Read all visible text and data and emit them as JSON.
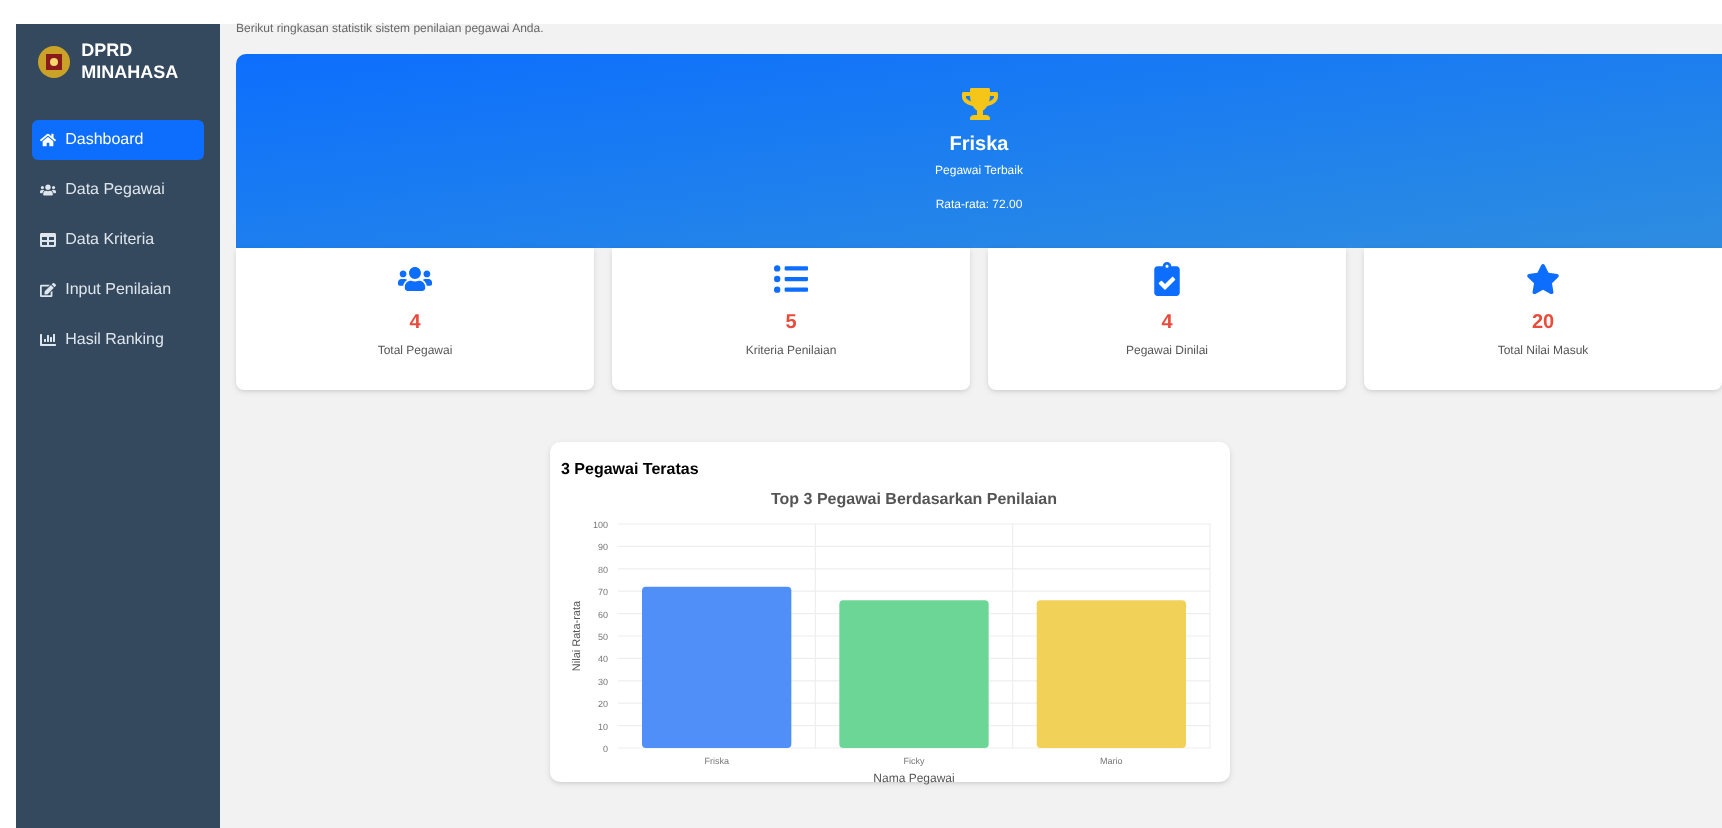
{
  "sidebar": {
    "brand": "DPRD MINAHASA",
    "items": [
      {
        "label": "Dashboard",
        "selected": true
      },
      {
        "label": "Data Pegawai",
        "selected": false
      },
      {
        "label": "Data Kriteria",
        "selected": false
      },
      {
        "label": "Input Penilaian",
        "selected": false
      },
      {
        "label": "Hasil Ranking",
        "selected": false
      }
    ]
  },
  "subtitle": "Berikut ringkasan statistik sistem penilaian pegawai Anda.",
  "best": {
    "name": "Friska",
    "label": "Pegawai Terbaik",
    "average": "Rata-rata: 72.00"
  },
  "stats": [
    {
      "value": "4",
      "label": "Total Pegawai"
    },
    {
      "value": "5",
      "label": "Kriteria Penilaian"
    },
    {
      "value": "4",
      "label": "Pegawai Dinilai"
    },
    {
      "value": "20",
      "label": "Total Nilai Masuk"
    }
  ],
  "chart_card": {
    "title": "3 Pegawai Teratas",
    "chart_data": {
      "type": "bar",
      "title": "Top 3 Pegawai Berdasarkan Penilaian",
      "xlabel": "Nama Pegawai",
      "ylabel": "Nilai Rata-rata",
      "categories": [
        "Friska",
        "Ficky",
        "Mario"
      ],
      "values": [
        72,
        66,
        66
      ],
      "colors": [
        "#4f8ff7",
        "#6cd696",
        "#f2d158"
      ],
      "grid": true,
      "ylim": [
        0,
        100
      ],
      "yticks": [
        0,
        10,
        20,
        30,
        40,
        50,
        60,
        70,
        80,
        90,
        100
      ]
    }
  }
}
